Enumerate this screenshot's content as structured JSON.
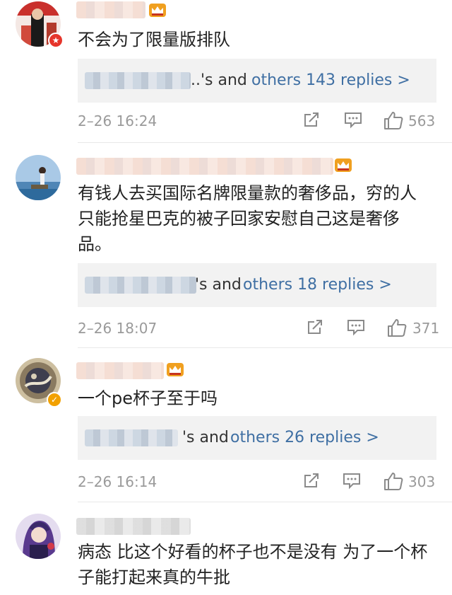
{
  "comments": [
    {
      "text": "不会为了限量版排队",
      "reply_suffix": "..'s and ",
      "reply_link": "others 143 replies >",
      "time": "2–26 16:24",
      "likes": "563",
      "verified_color": "#e6352b",
      "avatar_colors": [
        "#c9302c",
        "#111111"
      ]
    },
    {
      "text": "有钱人去买国际名牌限量款的奢侈品，穷的人只能抢星巴克的被子回家安慰自己这是奢侈品。",
      "reply_suffix": "'s and ",
      "reply_link": "others 18 replies >",
      "time": "2–26 18:07",
      "likes": "371",
      "avatar_colors": [
        "#8bb4d8",
        "#2b6da6"
      ]
    },
    {
      "text": "一个pe杯子至于吗",
      "reply_suffix": "'s and ",
      "reply_link": "others 26 replies >",
      "time": "2–26 16:14",
      "likes": "303",
      "verified_color": "#f2a100",
      "avatar_colors": [
        "#b8a88a",
        "#4a4a5a"
      ]
    },
    {
      "text": "病态   比这个好看的杯子也不是没有    为了一个杯子能打起来真的牛批",
      "avatar_colors": [
        "#6b3fa0",
        "#2a1f4d"
      ]
    }
  ],
  "colors": {
    "link": "#3f6fa3",
    "meta": "#9a9a9a",
    "reply_bg": "#f2f2f2",
    "crown": "#f0a020"
  },
  "icons": {
    "share": "share-icon",
    "comment": "comment-icon",
    "like": "thumbs-up-icon",
    "member": "crown-icon"
  }
}
